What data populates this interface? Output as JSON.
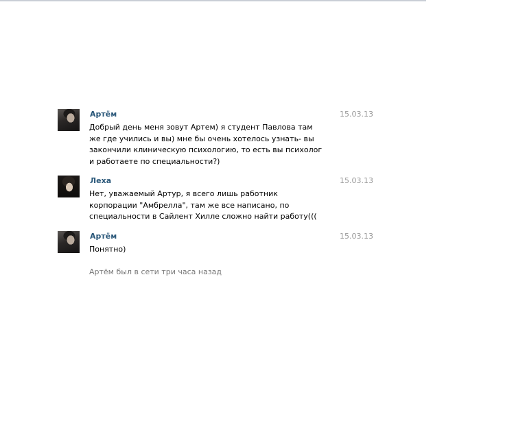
{
  "messages": [
    {
      "author": "Артём",
      "date": "15.03.13",
      "avatar": "user-photo-artem",
      "text": "Добрый день меня зовут Артем) я студент Павлова там же где учились и вы) мне бы очень хотелось узнать- вы закончили клиническую психологию, то есть вы психолог и работаете по специальности?)"
    },
    {
      "author": "Леха",
      "date": "15.03.13",
      "avatar": "user-photo-leha",
      "text": "Нет, уважаемый Артур, я всего лишь работник корпорации \"Амбрелла\", там же все написано, по специальности в Сайлент Хилле сложно найти работу((("
    },
    {
      "author": "Артём",
      "date": "15.03.13",
      "avatar": "user-photo-artem",
      "text": "Понятно)"
    }
  ],
  "status": {
    "text": "Артём был в сети три часа назад"
  },
  "colors": {
    "author_link": "#2b587a",
    "date": "#999999",
    "status": "#777777",
    "top_rule": "#c9ced6"
  }
}
